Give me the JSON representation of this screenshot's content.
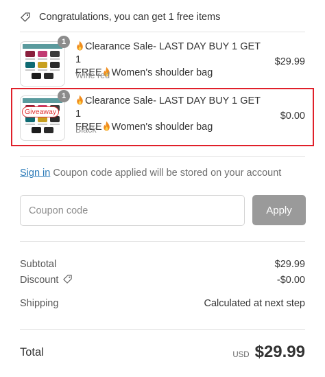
{
  "promo": {
    "text": "Congratulations, you can get 1 free items"
  },
  "items": [
    {
      "quantity": "1",
      "title_line1": "Clearance Sale- LAST DAY BUY 1 GET 1",
      "title_line2": "FREE",
      "title_line2_suffix": "Women's shoulder bag",
      "variant": "Wine red",
      "price": "$29.99",
      "banner_text": "Love style"
    },
    {
      "quantity": "1",
      "badge": "Giveaway",
      "title_line1": "Clearance Sale- LAST DAY BUY 1 GET 1",
      "title_line2": "FREE",
      "title_line2_suffix": "Women's shoulder bag",
      "variant": "Black",
      "price": "$0.00"
    }
  ],
  "signin": {
    "link": "Sign in",
    "text": " Coupon code applied will be stored on your account"
  },
  "coupon": {
    "placeholder": "Coupon code",
    "value": "",
    "button": "Apply"
  },
  "summary": {
    "subtotal_label": "Subtotal",
    "subtotal_value": "$29.99",
    "discount_label": "Discount",
    "discount_value": "-$0.00",
    "shipping_label": "Shipping",
    "shipping_value": "Calculated at next step"
  },
  "total": {
    "label": "Total",
    "currency": "USD",
    "value": "$29.99"
  },
  "colors": {
    "link": "#2a7ab8",
    "highlight": "#e0202a",
    "giveaway": "#e03030",
    "apply_bg": "#9a9a9a",
    "fire": "#f08c1c"
  },
  "icons": [
    "tag-icon",
    "fire-icon",
    "discount-tag-icon"
  ]
}
